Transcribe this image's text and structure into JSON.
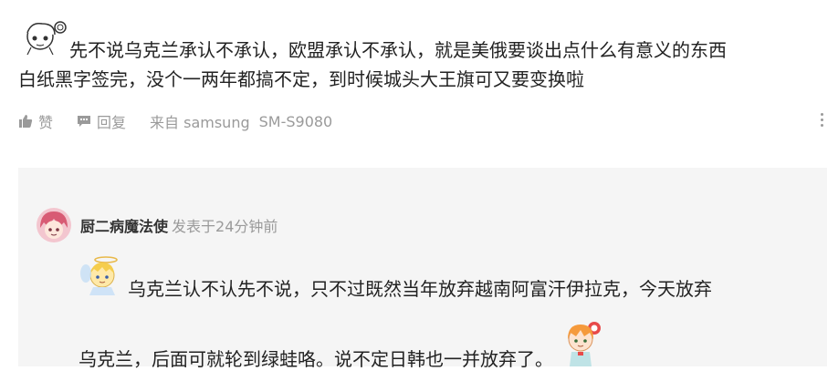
{
  "post": {
    "line1": "先不说乌克兰承认不承认，欧盟承认不承认，就是美俄要谈出点什么有意义的东西",
    "line2": "白纸黑字签完，没个一两年都搞不定，到时候城头大王旗可又要变换啦"
  },
  "actions": {
    "like_label": "赞",
    "reply_label": "回复",
    "from_label": "来自 samsung",
    "device": "SM-S9080"
  },
  "reply": {
    "author": "厨二病魔法使",
    "time": "发表于24分钟前",
    "line1": "乌克兰认不认先不说，只不过既然当年放弃越南阿富汗伊拉克，今天放弃",
    "line2": "乌克兰，后面可就轮到绿蛙咯。说不定日韩也一并放弃了。"
  },
  "icons": {
    "like": "thumbs-up-icon",
    "reply": "comment-icon",
    "more": "more-vertical-icon"
  },
  "colors": {
    "text": "#222222",
    "muted": "#9a9a9a",
    "reply_bg": "#f5f5f5"
  }
}
